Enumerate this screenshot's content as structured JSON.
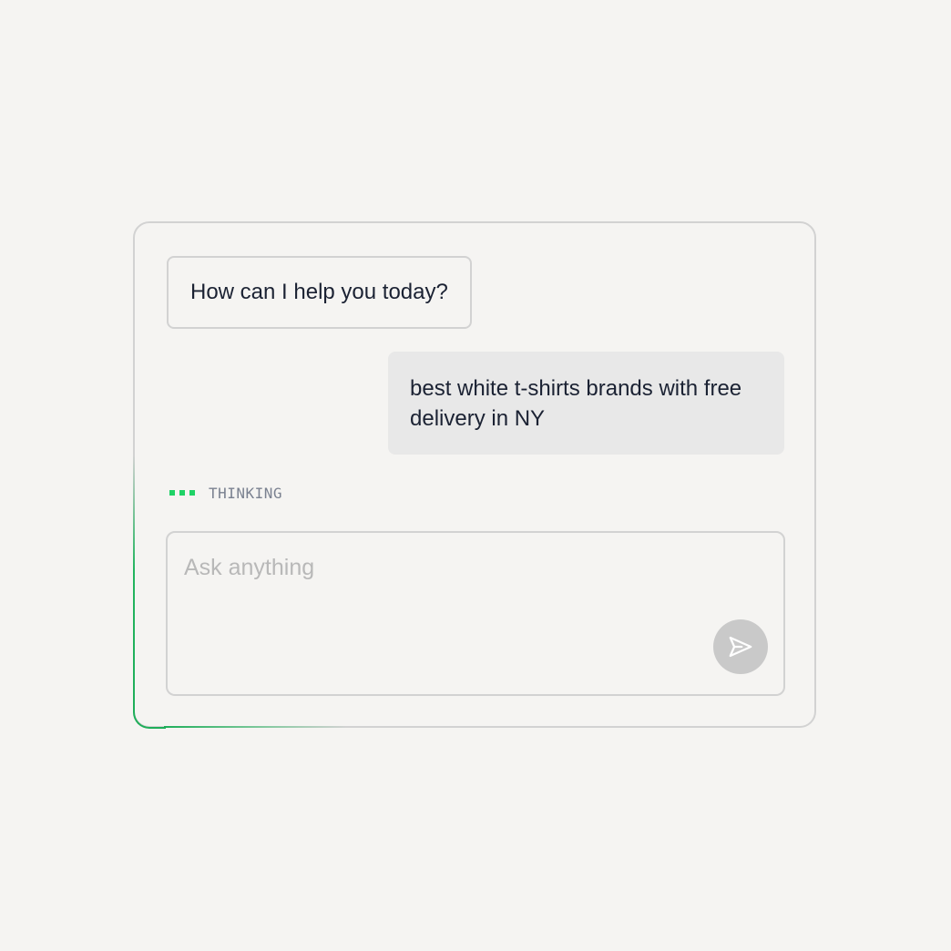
{
  "messages": {
    "assistant": "How can I help you today?",
    "user": "best white t-shirts brands with free delivery in NY"
  },
  "status": {
    "label": "THINKING"
  },
  "composer": {
    "placeholder": "Ask anything",
    "value": "",
    "send_icon": "send-icon"
  },
  "colors": {
    "background": "#f5f4f2",
    "border": "#d2d2d2",
    "accent": "#1fd266",
    "user_bubble": "#e8e8e8",
    "send_button": "#c9c9c9"
  }
}
